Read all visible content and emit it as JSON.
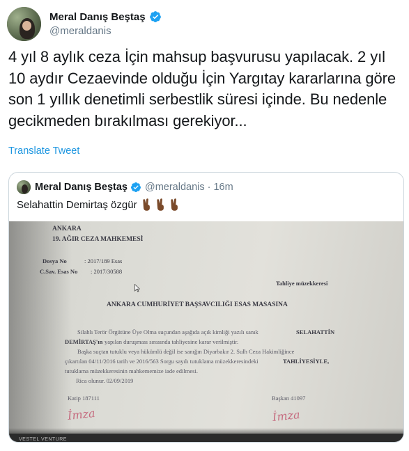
{
  "author": {
    "name": "Meral Danış Beştaş",
    "handle": "@meraldanis",
    "verified_icon": "verified-badge-icon"
  },
  "tweet": {
    "text": "4 yıl 8 aylık ceza İçin mahsup başvurusu yapılacak. 2 yıl 10 aydır Cezaevinde olduğu İçin Yargıtay kararlarına göre son 1 yıllık denetimli serbestlik süresi içinde. Bu nedenle gecikmeden bırakılması gerekiyor...",
    "translate_label": "Translate Tweet"
  },
  "quoted_tweet": {
    "name": "Meral Danış Beştaş",
    "handle": "@meraldanis",
    "separator": "·",
    "time": "16m",
    "text": "Selahattin Demirtaş özgür",
    "emoji_icon": "victory-hand-icon",
    "document": {
      "court_line1": "ANKARA",
      "court_line2": "19. AĞIR CEZA MAHKEMESİ",
      "dosya_label": "Dosya No",
      "dosya_value": ": 2017/189 Esas",
      "csav_label": "C.Sav. Esas No",
      "csav_value": ": 2017/30588",
      "doc_type": "Tahliye müzekkeresi",
      "recipient": "ANKARA CUMHURİYET BAŞSAVCILIĞI ESAS MASASINA",
      "body_line1a": "Silahlı Terör Örgütüne Üye Olma suçundan aşağıda açık kimliği yazılı sanık",
      "body_line1b": "SELAHATTİN",
      "body_line2a": "DEMİRTAŞ'ın",
      "body_line2b": "yapılan duruşması sırasında tahliyesine karar verilmiştir.",
      "body_line3": "Başka suçtan tutuklu veya hükümlü değil ise sanığın Diyarbakır 2. Sulh Ceza Hakimliğince",
      "body_line4a": "çıkartılan 04/11/2016 tarih ve 2016/563 Sorgu sayılı tutuklama müzekkeresindeki",
      "body_line4b": "TAHLİYESİYLE,",
      "body_line5": "tutuklama müzekkeresinin mahkememize iade edilmesi.",
      "date_line": "Rica olunur. 02/09/2019",
      "katip": "Katip 187111",
      "baskan": "Başkan 41097",
      "signature": "İmza",
      "bottom_label": "VESTEL VENTURE"
    }
  },
  "colors": {
    "link": "#1b95e0",
    "secondary_text": "#657786",
    "border": "#ccd6dd",
    "signature": "#c0506a"
  }
}
